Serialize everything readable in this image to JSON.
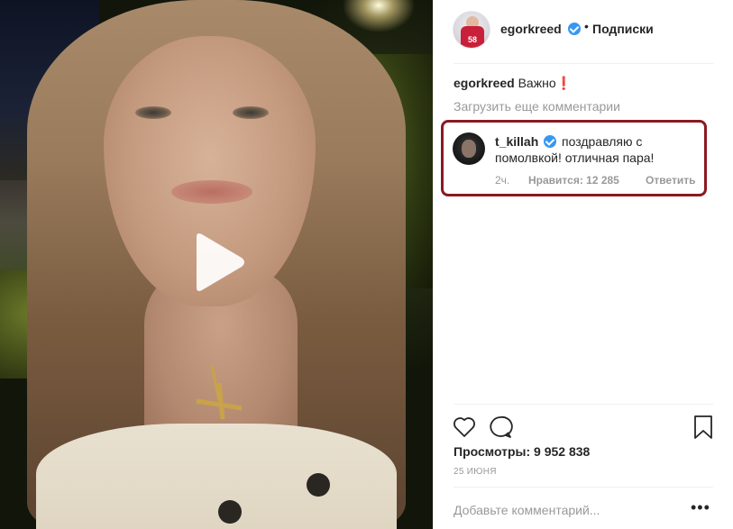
{
  "post": {
    "author": "egorkreed",
    "verified": true,
    "separator": "•",
    "follow_status": "Подписки",
    "avatar_jersey_number": "58"
  },
  "caption": {
    "author": "egorkreed",
    "text": "Важно",
    "emoji": "❗"
  },
  "load_more_label": "Загрузить еще комментарии",
  "highlighted_comment": {
    "user": "t_killah",
    "verified": true,
    "text": "поздравляю с помолвкой! отличная пара!",
    "time": "2ч.",
    "likes": "Нравится: 12 285",
    "reply_label": "Ответить",
    "highlight_color": "#8a1a22"
  },
  "actions": {
    "like_icon": "heart-icon",
    "comment_icon": "comment-icon",
    "save_icon": "bookmark-icon"
  },
  "stats": {
    "views": "Просмотры: 9 952 838",
    "date": "25 ИЮНЯ"
  },
  "add_comment": {
    "placeholder": "Добавьте комментарий...",
    "more_label": "•••"
  },
  "media": {
    "type": "video",
    "play_icon": "play-icon"
  },
  "colors": {
    "accent_verified": "#3897f0",
    "text_primary": "#262626",
    "text_secondary": "#999999"
  }
}
